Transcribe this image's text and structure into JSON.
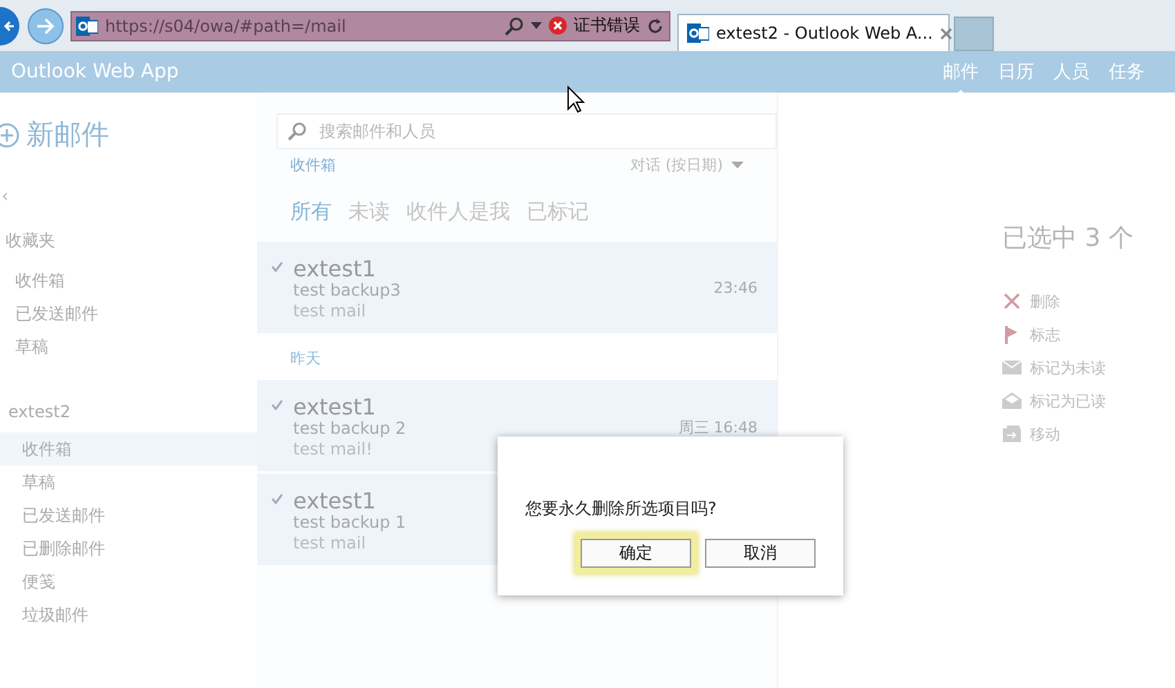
{
  "browser": {
    "address": "https://s04/owa/#path=/mail",
    "cert_error": "证书错误",
    "tabs": [
      {
        "title": "extest2 - Outlook Web A...",
        "selected": true
      }
    ]
  },
  "app": {
    "title": "Outlook Web App",
    "nav": [
      {
        "label": "邮件",
        "selected": true
      },
      {
        "label": "日历",
        "selected": false
      },
      {
        "label": "人员",
        "selected": false
      },
      {
        "label": "任务",
        "selected": false
      }
    ]
  },
  "sidebar": {
    "new_mail": "新邮件",
    "collapse": "‹",
    "groups": [
      {
        "name": "收藏夹",
        "items": [
          {
            "label": "收件箱",
            "selected": false
          },
          {
            "label": "已发送邮件",
            "selected": false
          },
          {
            "label": "草稿",
            "selected": false
          }
        ]
      },
      {
        "name": "extest2",
        "items": [
          {
            "label": "收件箱",
            "selected": true
          },
          {
            "label": "草稿",
            "selected": false
          },
          {
            "label": "已发送邮件",
            "selected": false
          },
          {
            "label": "已删除邮件",
            "selected": false
          },
          {
            "label": "便笺",
            "selected": false
          },
          {
            "label": "垃圾邮件",
            "selected": false
          }
        ]
      }
    ]
  },
  "message_list": {
    "search": {
      "placeholder": "搜索邮件和人员"
    },
    "folder": "收件箱",
    "sort": "对话 (按日期)",
    "filters": [
      {
        "label": "所有",
        "selected": true
      },
      {
        "label": "未读",
        "selected": false
      },
      {
        "label": "收件人是我",
        "selected": false
      },
      {
        "label": "已标记",
        "selected": false
      }
    ],
    "items": [
      {
        "kind": "message",
        "sender": "extest1",
        "subject": "test backup3",
        "preview": "test mail",
        "time": "23:46",
        "checked": true
      },
      {
        "kind": "date_header",
        "label": "昨天"
      },
      {
        "kind": "message",
        "sender": "extest1",
        "subject": "test backup 2",
        "preview": "test mail!",
        "time": "周三 16:48",
        "checked": true
      },
      {
        "kind": "message",
        "sender": "extest1",
        "subject": "test backup 1",
        "preview": "test mail",
        "checked": true
      }
    ]
  },
  "reading_pane": {
    "selection": "已选中 3 个",
    "actions": [
      {
        "kind": "delete",
        "label": "删除"
      },
      {
        "kind": "flag",
        "label": "标志"
      },
      {
        "kind": "unread",
        "label": "标记为未读"
      },
      {
        "kind": "read",
        "label": "标记为已读"
      },
      {
        "kind": "move",
        "label": "移动"
      }
    ]
  },
  "dialog": {
    "message": "您要永久删除所选项目吗?",
    "buttons": [
      {
        "label": "确定",
        "focused": true
      },
      {
        "label": "取消",
        "focused": false
      }
    ]
  }
}
